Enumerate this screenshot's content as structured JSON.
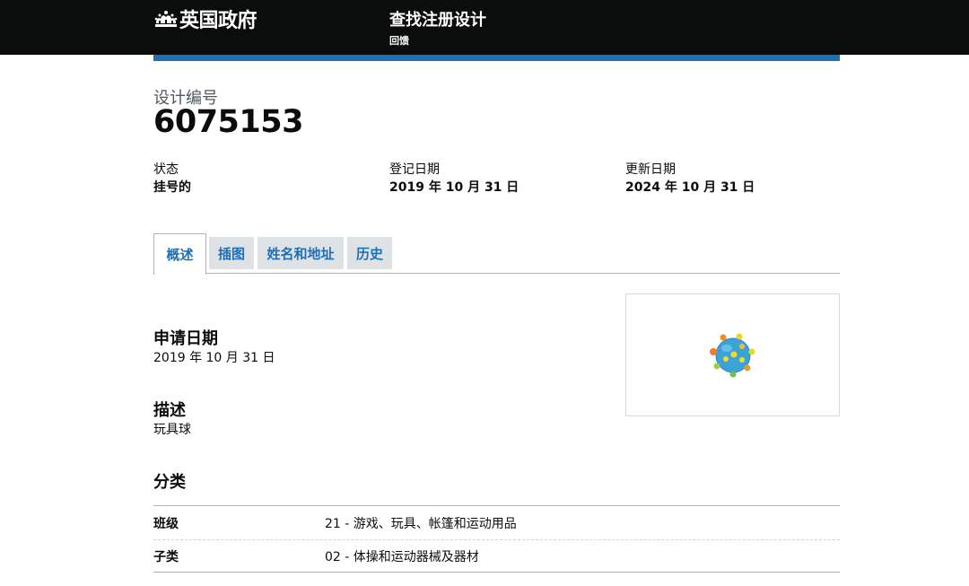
{
  "header": {
    "logo_text": "英国政府",
    "service_name": "查找注册设计",
    "feedback_link": "回馈"
  },
  "design": {
    "caption": "设计编号",
    "number": "6075153"
  },
  "meta": {
    "status_label": "状态",
    "status_value": "挂号的",
    "registered_label": "登记日期",
    "registered_value": "2019 年 10 月 31 日",
    "renewed_label": "更新日期",
    "renewed_value": "2024 年 10 月 31 日"
  },
  "tabs": [
    {
      "label": "概述",
      "active": true
    },
    {
      "label": "插图",
      "active": false
    },
    {
      "label": "姓名和地址",
      "active": false
    },
    {
      "label": "历史",
      "active": false
    }
  ],
  "overview": {
    "filing_date_heading": "申请日期",
    "filing_date_value": "2019 年 10 月 31 日",
    "description_heading": "描述",
    "description_value": "玩具球",
    "classification_heading": "分类",
    "image_subject": "spiky toy ball"
  },
  "classification": [
    {
      "key": "班级",
      "value": "21 - 游戏、玩具、帐篷和运动用品"
    },
    {
      "key": "子类",
      "value": "02 - 体操和运动器械及器材"
    }
  ],
  "colors": {
    "header_bg": "#0b0c0c",
    "brand_blue": "#1d70b8",
    "tab_bg": "#dfe2e4"
  }
}
